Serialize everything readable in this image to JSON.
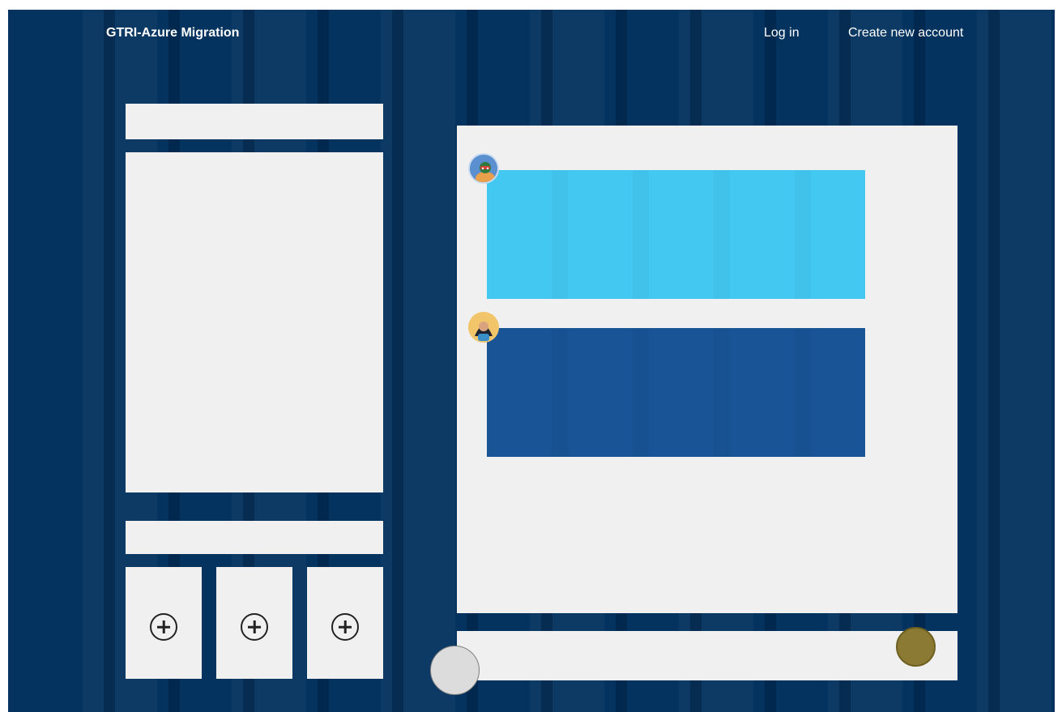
{
  "header": {
    "brand": "GTRI-Azure Migration",
    "login_label": "Log in",
    "create_account_label": "Create new account"
  },
  "colors": {
    "background": "#03335e",
    "panel": "#f0f0f0",
    "message_light": "#43c8f1",
    "message_dark": "#195496",
    "send_button": "#8b7a33"
  },
  "icons": {
    "add_tile": "plus-circle-icon",
    "send": "send-button",
    "attach": "attach-button"
  }
}
